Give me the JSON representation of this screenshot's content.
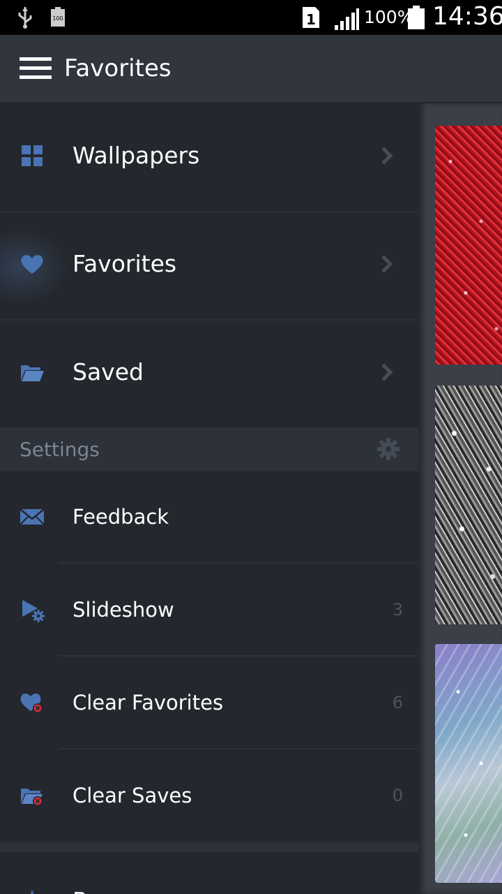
{
  "status_bar": {
    "battery_percent": "100%",
    "time": "14:36",
    "sim_slot": "1",
    "small_battery_label": "100",
    "icons": [
      "usb-icon",
      "battery-full-small-icon",
      "sim-1-icon",
      "signal-icon",
      "battery-icon"
    ]
  },
  "app_bar": {
    "title": "Favorites",
    "menu_icon": "hamburger-menu-icon"
  },
  "drawer": {
    "nav_items": [
      {
        "label": "Wallpapers",
        "icon": "grid-icon",
        "active": false
      },
      {
        "label": "Favorites",
        "icon": "heart-icon",
        "active": true
      },
      {
        "label": "Saved",
        "icon": "folder-open-icon",
        "active": false
      }
    ],
    "settings_section": {
      "title": "Settings",
      "icon": "gear-icon"
    },
    "settings_items": [
      {
        "label": "Feedback",
        "icon": "envelope-icon",
        "count": ""
      },
      {
        "label": "Slideshow",
        "icon": "slideshow-settings-icon",
        "count": "3"
      },
      {
        "label": "Clear Favorites",
        "icon": "heart-clear-icon",
        "count": "6"
      },
      {
        "label": "Clear Saves",
        "icon": "folder-clear-icon",
        "count": "0"
      }
    ],
    "bottom_item": {
      "label": "R",
      "icon": "star-icon"
    }
  },
  "content": {
    "thumbnails": [
      "red glitter",
      "silver glitter",
      "pastel sparkle"
    ]
  },
  "colors": {
    "accent_icon": "#4a74b4",
    "drawer_bg": "#24272d",
    "app_bar_bg": "#30353e",
    "clear_badge": "#d0303a"
  }
}
